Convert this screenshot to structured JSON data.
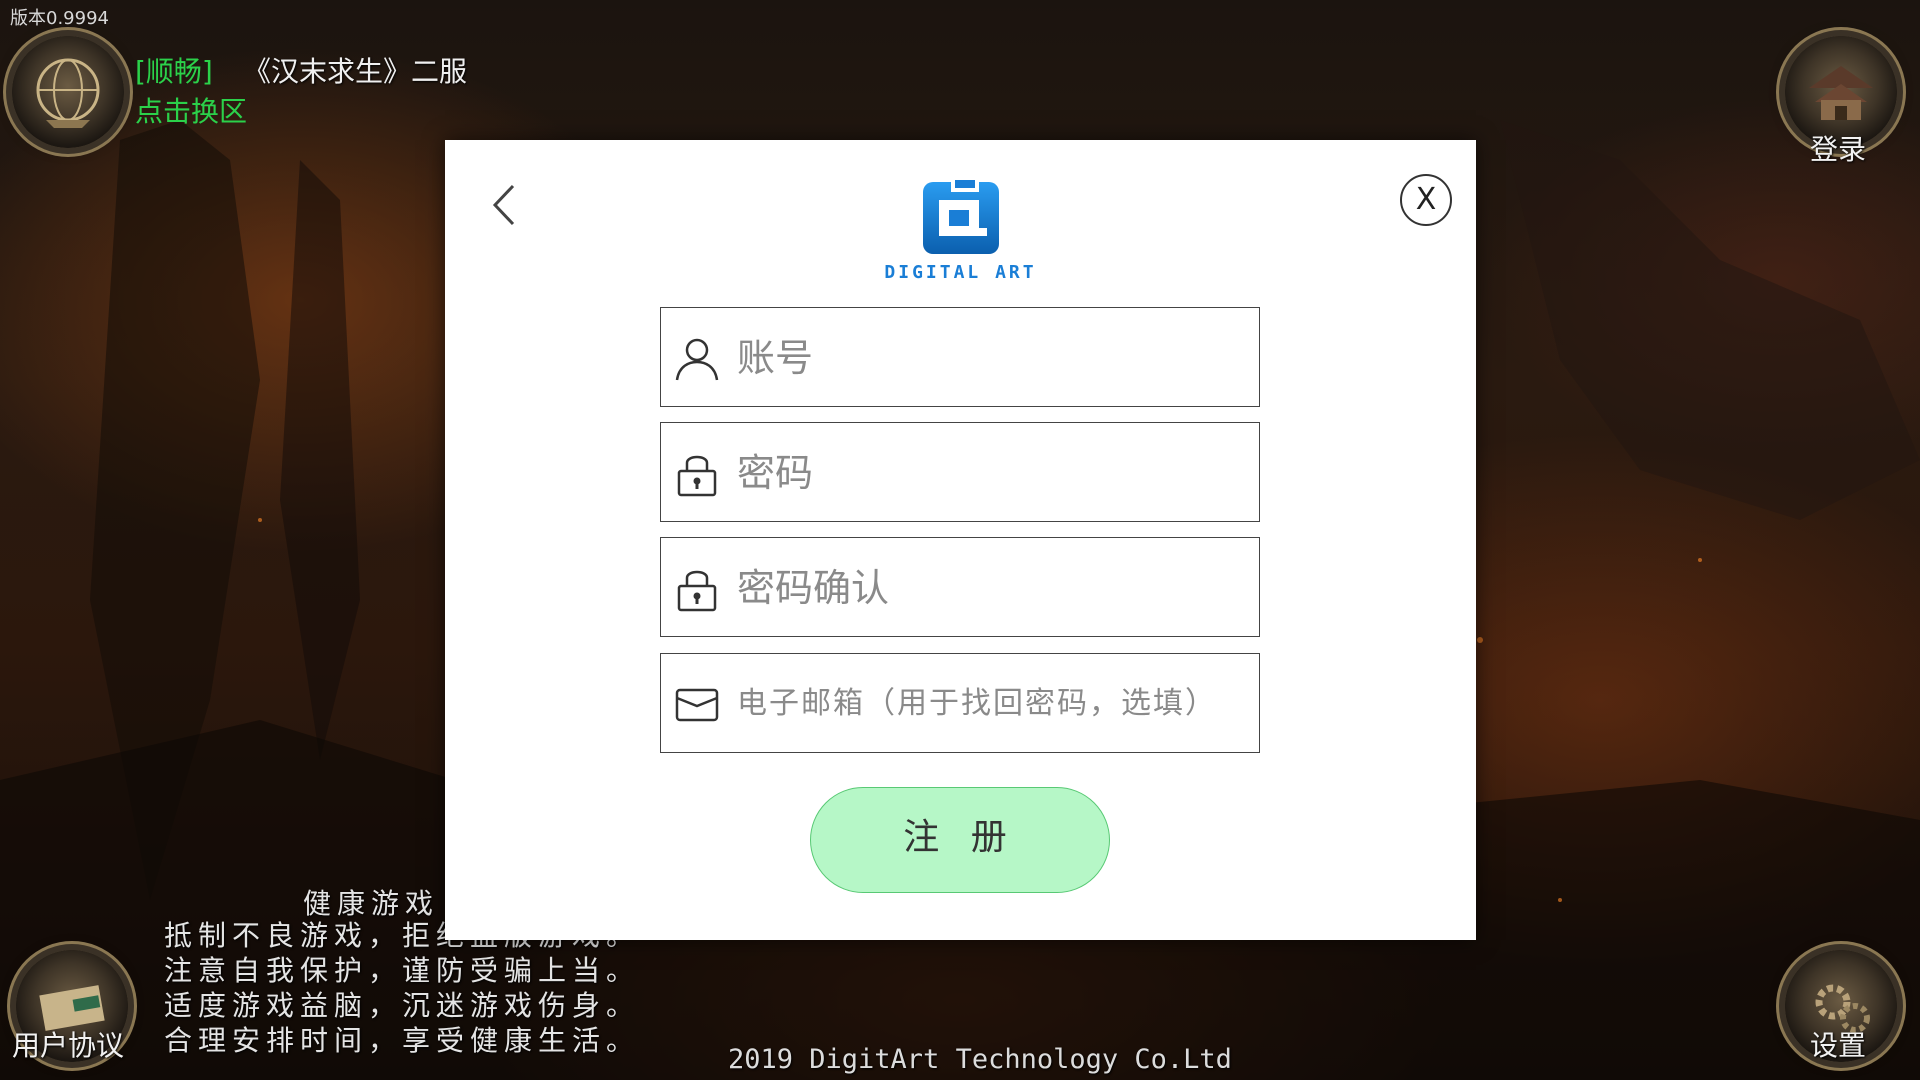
{
  "version_text": "版本0.9994",
  "server": {
    "status": "[顺畅]",
    "name": "《汉末求生》二服",
    "switch_label": "点击换区"
  },
  "corner_buttons": {
    "login_label": "登录",
    "user_agreement_label": "用户协议",
    "settings_label": "设置"
  },
  "health_notice": {
    "title": "健康游戏",
    "lines": [
      "抵制不良游戏，拒绝盗版游戏。",
      "注意自我保护，谨防受骗上当。",
      "适度游戏益脑，沉迷游戏伤身。",
      "合理安排时间，享受健康生活。"
    ]
  },
  "copyright": "2019 DigitArt Technology Co.Ltd",
  "dialog": {
    "logo_text": "DIGITAL ART",
    "close_label": "X",
    "fields": {
      "account_placeholder": "账号",
      "password_placeholder": "密码",
      "confirm_placeholder": "密码确认",
      "email_placeholder": "电子邮箱（用于找回密码，选填）"
    },
    "register_label": "注 册"
  },
  "colors": {
    "status_green": "#2bd14a",
    "logo_blue": "#1a7ed6",
    "register_bg": "#b6f7c7"
  }
}
